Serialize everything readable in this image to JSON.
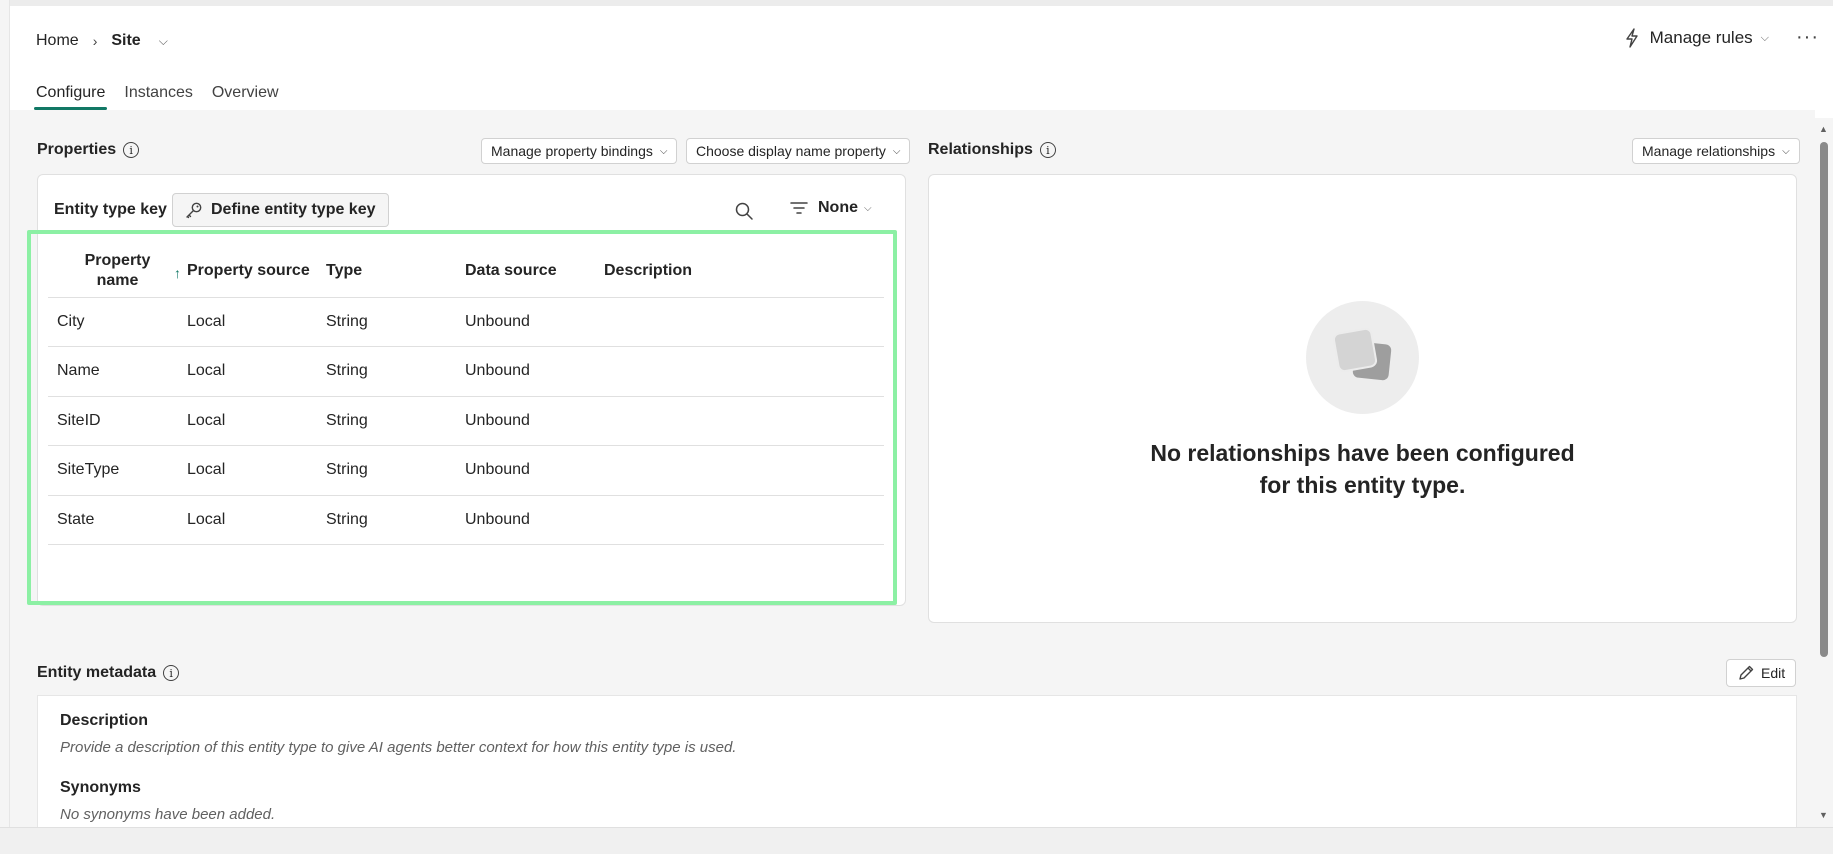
{
  "breadcrumb": {
    "home": "Home",
    "current": "Site"
  },
  "header": {
    "manage_rules": "Manage rules",
    "more": "···"
  },
  "tabs": [
    {
      "label": "Configure",
      "active": true
    },
    {
      "label": "Instances",
      "active": false
    },
    {
      "label": "Overview",
      "active": false
    }
  ],
  "properties": {
    "title": "Properties",
    "manage_bindings": "Manage property bindings",
    "choose_display": "Choose display name property",
    "entity_type_key_label": "Entity type key",
    "define_key_button": "Define entity type key",
    "filter_label": "None",
    "columns": {
      "property_name": "Property name",
      "property_source": "Property source",
      "type": "Type",
      "data_source": "Data source",
      "description": "Description"
    },
    "rows": [
      {
        "name": "City",
        "source": "Local",
        "type": "String",
        "data_source": "Unbound",
        "description": ""
      },
      {
        "name": "Name",
        "source": "Local",
        "type": "String",
        "data_source": "Unbound",
        "description": ""
      },
      {
        "name": "SiteID",
        "source": "Local",
        "type": "String",
        "data_source": "Unbound",
        "description": ""
      },
      {
        "name": "SiteType",
        "source": "Local",
        "type": "String",
        "data_source": "Unbound",
        "description": ""
      },
      {
        "name": "State",
        "source": "Local",
        "type": "String",
        "data_source": "Unbound",
        "description": ""
      }
    ]
  },
  "relationships": {
    "title": "Relationships",
    "manage_button": "Manage relationships",
    "empty_line1": "No relationships have been configured",
    "empty_line2": "for this entity type."
  },
  "metadata": {
    "title": "Entity metadata",
    "edit_button": "Edit",
    "description_heading": "Description",
    "description_text": "Provide a description of this entity type to give AI agents better context for how this entity type is used.",
    "synonyms_heading": "Synonyms",
    "synonyms_text": "No synonyms have been added."
  },
  "colors": {
    "accent": "#117865",
    "highlight": "#8cf0a4"
  }
}
